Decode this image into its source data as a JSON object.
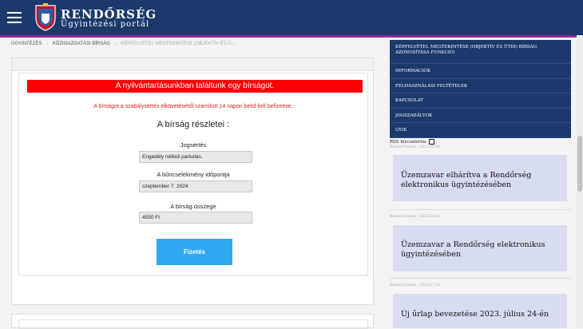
{
  "header": {
    "title": "RENDŐRSÉG",
    "subtitle": "Ügyintézési portál",
    "menu_icon": "hamburger-icon",
    "logo_icon": "police-crest-icon"
  },
  "breadcrumb": {
    "items": [
      "ÜGYINTÉZÉS",
      "KÖZIGAZGATÁSI BÍRSÁG",
      "KÉPFELVÉTEL MEGTEKINTÉSE (OBJEKTÍV ÉS Ü..."
    ],
    "separator": "›"
  },
  "main": {
    "alert": "A nyilvántartásunkban találtunk egy bírságot.",
    "notice": "A bírságot a szabálysértés elkövetésétől számított 14 napon belül kell befizetnie.",
    "details_title": "A bírság részletei :",
    "fields": [
      {
        "label": "Jogsértés",
        "value": "Engedély nélküli parkolás."
      },
      {
        "label": "A bűncselekmény időpontja",
        "value": "szeptember 7. 2024"
      },
      {
        "label": "A bírság összege",
        "value": "4550 Ft"
      }
    ],
    "pay_button": "Fizetés"
  },
  "sidebar": {
    "menu": [
      "KÉPFELVÉTEL MEGTEKINTÉSE (OBJEKTÍV ÉS ÜTDI) BÍRSÁG AZONOSÍTÁSA FUNKCIÓ)",
      "INFORMÁCIÓK",
      "FELHASZNÁLÁSI FELTÉTELEK",
      "KAPCSOLAT",
      "JOGSZABÁLYOK",
      "GYIK"
    ],
    "rss_label": "RSS hírcsatorna",
    "news": [
      {
        "meta": "Roland Szántó - 2023.09.03.",
        "title": "Üzemzavar elhárítva a Rendőrség elektronikus ügyintézésében"
      },
      {
        "meta": "Roland Szántó - 2023.09.03.",
        "title": "Üzemzavar a Rendőrség elektronikus ügyintézésében"
      },
      {
        "meta": "Roland Szántó - 2023.07.23.",
        "title": "Új űrlap bevezetése 2023. július 24-én"
      }
    ]
  },
  "colors": {
    "header_bg": "#1b3a6b",
    "alert_bg": "#ff0000",
    "notice_text": "#e31b1b",
    "pay_button_bg": "#2fa8f1",
    "news_bg": "#d8dcef"
  }
}
